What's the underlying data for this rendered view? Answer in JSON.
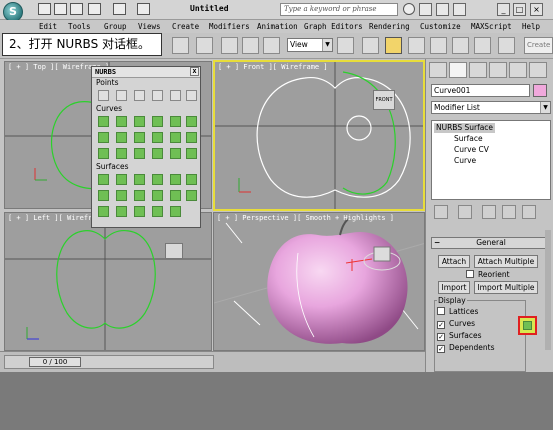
{
  "title_bar": {
    "title": "Untitled",
    "search_placeholder": "Type a keyword or phrase"
  },
  "menu": [
    "Edit",
    "Tools",
    "Group",
    "Views",
    "Create",
    "Modifiers",
    "Animation",
    "Graph Editors",
    "Rendering",
    "Customize",
    "MAXScript",
    "Help"
  ],
  "caption": "2、打开 NURBS 对话框。",
  "toolbar": {
    "view_dropdown": "View",
    "create_selection": "Create"
  },
  "viewports": {
    "top": "[ + ] Top ][ Wireframe ]",
    "front": "[ + ] Front ][ Wireframe ]",
    "left": "[ + ] Left ][ Wireframe ]",
    "perspective": "[ + ] Perspective ][ Smooth + Highlights ]",
    "viewcube_label": "FRONT"
  },
  "nurbs_panel": {
    "title": "NURBS",
    "close": "x",
    "sections": [
      "Points",
      "Curves",
      "Surfaces"
    ]
  },
  "command_panel": {
    "object_name": "Curve001",
    "object_color": "#f0a8dc",
    "modifier_list": "Modifier List",
    "stack": [
      "NURBS Surface",
      "Surface",
      "Curve CV",
      "Curve"
    ],
    "rollout_title": "General",
    "buttons": {
      "attach": "Attach",
      "attach_multiple": "Attach Multiple",
      "import": "Import",
      "import_multiple": "Import Multiple"
    },
    "reorient": {
      "label": "Reorient",
      "checked": false
    },
    "display_label": "Display",
    "display_options": [
      {
        "label": "Lattices",
        "checked": false
      },
      {
        "label": "Curves",
        "checked": true
      },
      {
        "label": "Surfaces",
        "checked": true
      },
      {
        "label": "Dependents",
        "checked": true
      }
    ]
  },
  "status": {
    "time": "0 / 100"
  },
  "colors": {
    "curve_green": "#2bd12b",
    "active_border": "#e8dd3a",
    "apple_pink": "#e8a6de",
    "highlight_red": "#e02020"
  }
}
